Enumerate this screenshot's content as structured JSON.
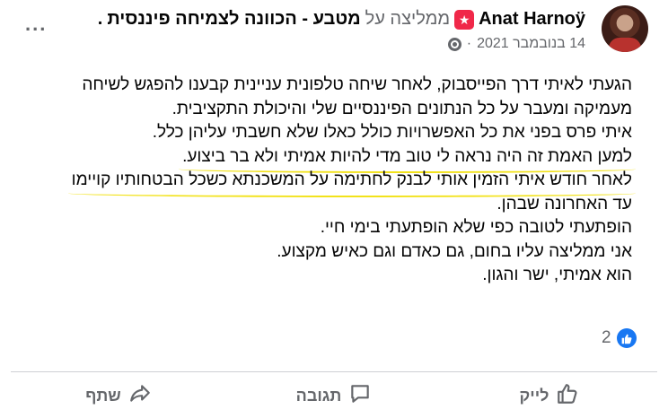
{
  "post": {
    "author": "Anat Harnoy",
    "author_display": "Anat Harnoÿ",
    "verb": "ממליצה על",
    "page_name": "מטבע - הכוונה לצמיחה פיננסית",
    "page_suffix": ".",
    "date": "14 בנובמבר 2021",
    "separator": "·",
    "more": "...",
    "lines": [
      "הגעתי לאיתי דרך הפייסבוק, לאחר שיחה טלפונית עניינית קבענו להפגש לשיחה",
      "מעמיקה ומעבר על כל הנתונים הפיננסיים שלי והיכולת התקציבית.",
      "איתי פרס בפני את כל האפשרויות כולל כאלו שלא חשבתי עליהן כלל.",
      "למען האמת זה היה נראה לי טוב מדי להיות אמיתי ולא בר ביצוע.",
      "לאחר חודש איתי הזמין אותי לבנק לחתימה על המשכנתא כשכל הבטחותיו קויימו",
      "עד האחרונה שבהן.",
      "הופתעתי לטובה כפי שלא הופתעתי בימי חיי.",
      "אני ממליצה עליו בחום, גם כאדם וגם כאיש מקצוע.",
      "הוא אמיתי, ישר והגון."
    ],
    "reaction_count": "2"
  },
  "actions": {
    "like": "לייק",
    "comment": "תגובה",
    "share": "שתף"
  },
  "colors": {
    "highlight": "#f2e21a",
    "recommend": "#f02849",
    "like_blue": "#1877f2",
    "muted": "#65676b"
  }
}
